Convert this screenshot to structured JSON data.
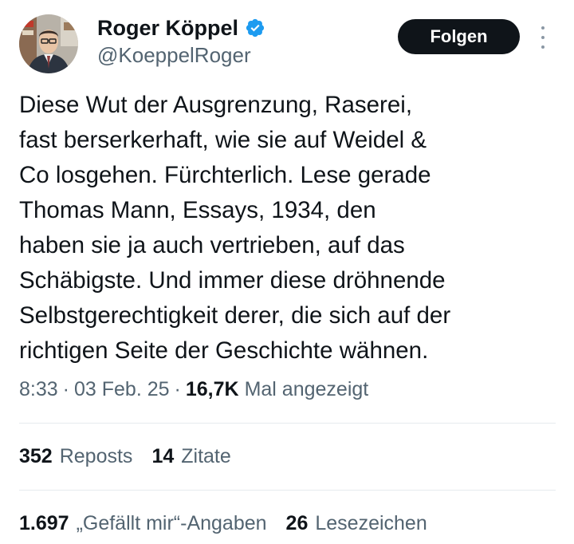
{
  "author": {
    "display_name": "Roger Köppel",
    "handle": "@KoeppelRoger",
    "verified_color": "#1d9bf0"
  },
  "actions": {
    "follow_label": "Folgen",
    "more_icon": "more-vertical-icon"
  },
  "tweet": {
    "lines": [
      "Diese Wut der Ausgrenzung, Raserei,",
      "fast berserkerhaft, wie sie auf Weidel &",
      "Co losgehen. Fürchterlich. Lese gerade",
      "Thomas Mann, Essays, 1934, den",
      "haben sie ja auch vertrieben, auf das",
      "Schäbigste. Und immer diese dröhnende",
      "Selbstgerechtigkeit derer, die sich auf der",
      "richtigen Seite der Geschichte wähnen."
    ]
  },
  "meta": {
    "time": "8:33",
    "separator": "·",
    "date": "03 Feb. 25",
    "views_count": "16,7K",
    "views_label": "Mal angezeigt"
  },
  "stats": {
    "reposts_count": "352",
    "reposts_label": "Reposts",
    "quotes_count": "14",
    "quotes_label": "Zitate",
    "likes_count": "1.697",
    "likes_label": "„Gefällt mir“-Angaben",
    "bookmarks_count": "26",
    "bookmarks_label": "Lesezeichen"
  }
}
